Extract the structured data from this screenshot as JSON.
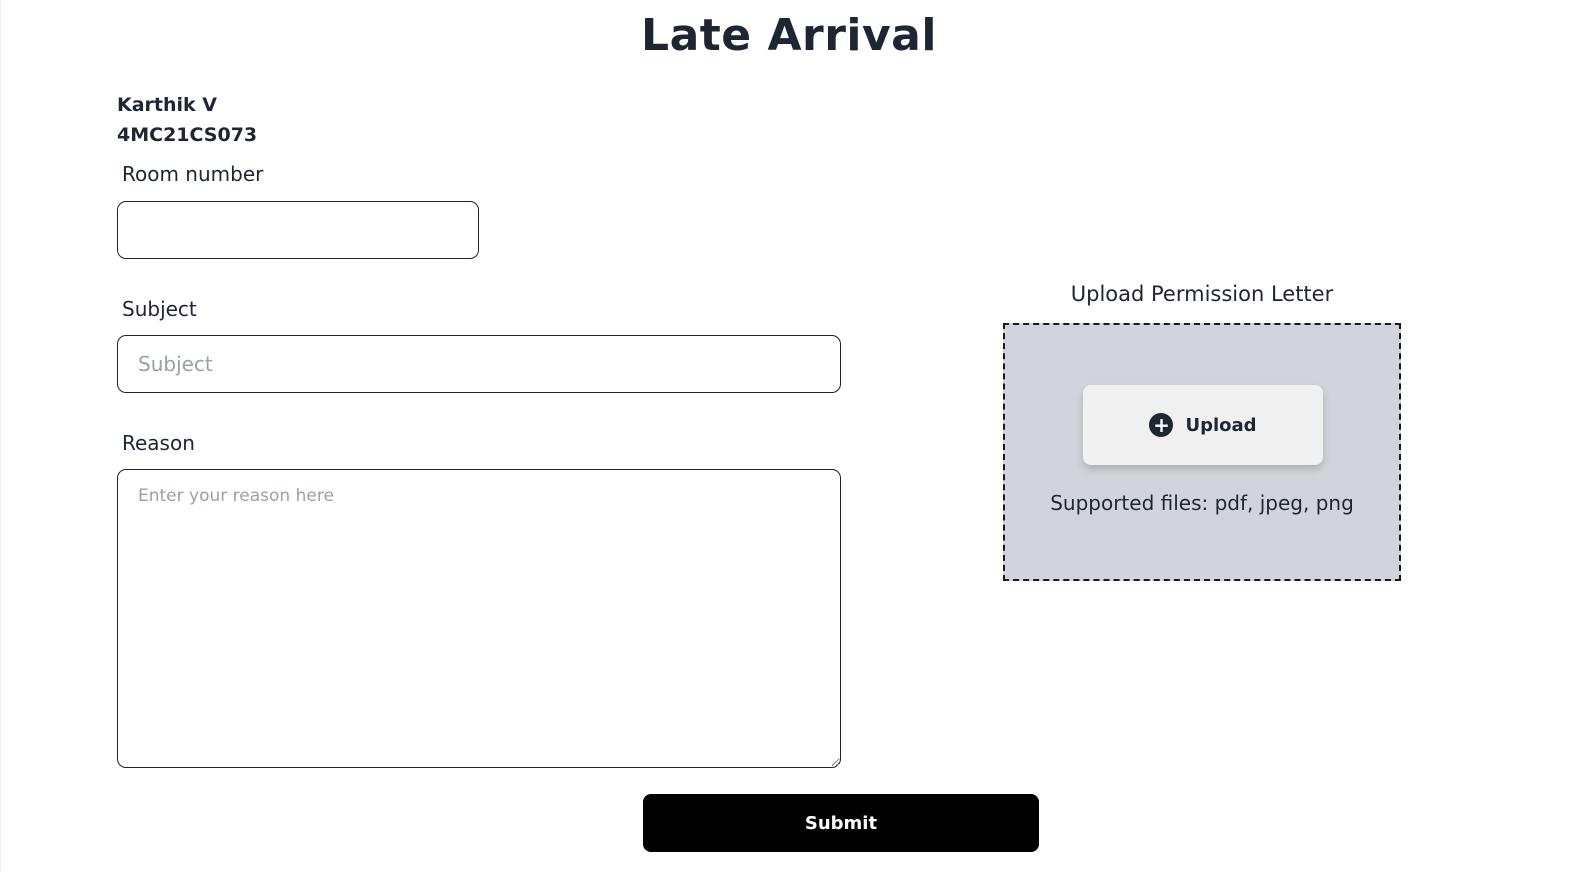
{
  "page": {
    "title": "Late Arrival"
  },
  "student": {
    "name": "Karthik V",
    "id": "4MC21CS073"
  },
  "form": {
    "room_label": "Room number",
    "room_value": "",
    "room_placeholder": "",
    "subject_label": "Subject",
    "subject_value": "",
    "subject_placeholder": "Subject",
    "reason_label": "Reason",
    "reason_value": "",
    "reason_placeholder": "Enter your reason here",
    "submit_label": "Submit"
  },
  "upload": {
    "title": "Upload Permission Letter",
    "button_label": "Upload",
    "button_icon": "plus-circle-icon",
    "supported_text": "Supported files: pdf, jpeg, png"
  },
  "colors": {
    "text": "#1e2533",
    "upload_bg": "#d1d5db",
    "submit_bg": "#000000"
  }
}
